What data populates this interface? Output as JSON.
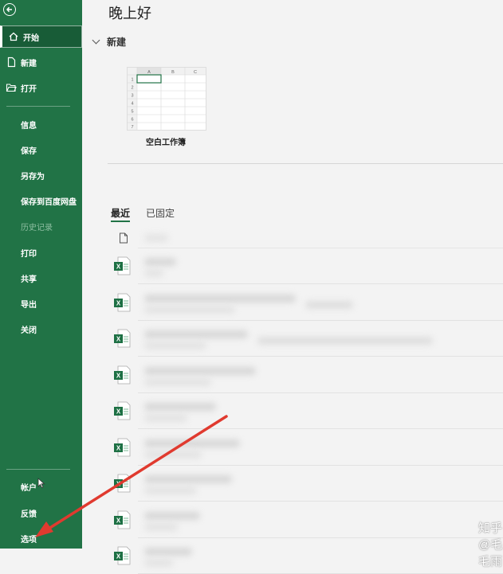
{
  "sidebar": {
    "items": [
      {
        "label": "开始",
        "icon": "home-icon",
        "active": true
      },
      {
        "label": "新建",
        "icon": "new-file-icon"
      },
      {
        "label": "打开",
        "icon": "open-folder-icon"
      },
      {
        "label": "信息"
      },
      {
        "label": "保存"
      },
      {
        "label": "另存为"
      },
      {
        "label": "保存到百度网盘"
      },
      {
        "label": "历史记录",
        "disabled": true
      },
      {
        "label": "打印"
      },
      {
        "label": "共享"
      },
      {
        "label": "导出"
      },
      {
        "label": "关闭"
      }
    ],
    "bottom_items": [
      {
        "label": "帐户"
      },
      {
        "label": "反馈"
      },
      {
        "label": "选项"
      }
    ]
  },
  "main": {
    "greeting": "晚上好",
    "new_section_title": "新建",
    "template_label": "空白工作簿",
    "template_grid": {
      "columns": [
        "A",
        "B",
        "C"
      ],
      "rows": [
        "1",
        "2",
        "3",
        "4",
        "5",
        "6",
        "7"
      ]
    },
    "tabs": [
      "最近",
      "已固定"
    ]
  },
  "watermark": "知乎 @毛毛雨",
  "colors": {
    "accent": "#217346",
    "arrow": "#e03a2f"
  }
}
